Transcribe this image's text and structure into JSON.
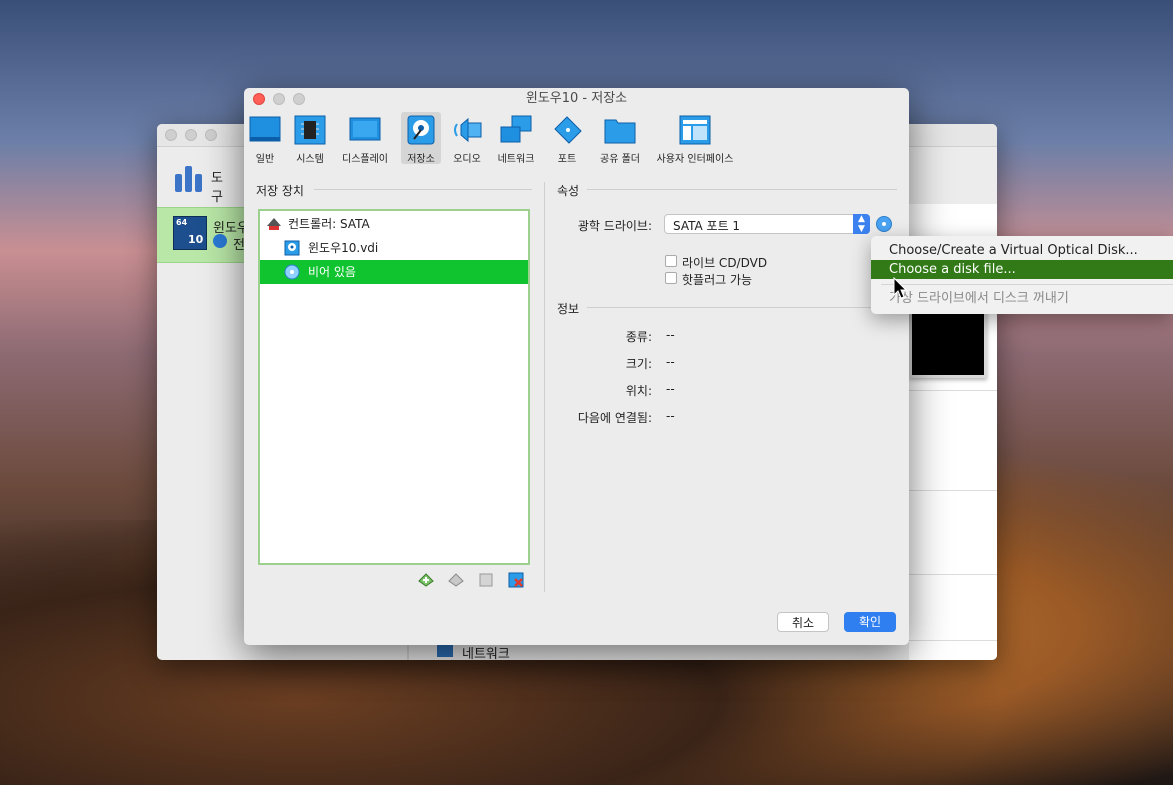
{
  "background_window": {
    "tools_label": "도구",
    "vm_name": "윈도우",
    "vm_state": "전",
    "vm_badge_64": "64",
    "vm_badge_10": "10",
    "bottom_item": "네트워크"
  },
  "dialog": {
    "title": "윈도우10 - 저장소",
    "toolbar": [
      {
        "label": "일반",
        "icon": "general-icon"
      },
      {
        "label": "시스템",
        "icon": "system-chip-icon"
      },
      {
        "label": "디스플레이",
        "icon": "display-icon"
      },
      {
        "label": "저장소",
        "icon": "storage-disk-icon",
        "selected": true
      },
      {
        "label": "오디오",
        "icon": "speaker-icon"
      },
      {
        "label": "네트워크",
        "icon": "network-icon"
      },
      {
        "label": "포트",
        "icon": "port-icon"
      },
      {
        "label": "공유 폴더",
        "icon": "folder-icon"
      },
      {
        "label": "사용자 인터페이스",
        "icon": "user-interface-icon"
      }
    ],
    "storage_devices": {
      "title": "저장 장치",
      "tree": [
        {
          "label": "컨트롤러: SATA",
          "type": "controller"
        },
        {
          "label": "윈도우10.vdi",
          "type": "hard-disk"
        },
        {
          "label": "비어 있음",
          "type": "optical-drive",
          "selected": true
        }
      ]
    },
    "attributes": {
      "title": "속성",
      "optical_drive_label": "광학 드라이브:",
      "optical_drive_value": "SATA 포트 1",
      "live_cd_label": "라이브 CD/DVD",
      "hotplug_label": "핫플러그 가능"
    },
    "info": {
      "title": "정보",
      "rows": [
        {
          "label": "종류:",
          "value": "--"
        },
        {
          "label": "크기:",
          "value": "--"
        },
        {
          "label": "위치:",
          "value": "--"
        },
        {
          "label": "다음에 연결됨:",
          "value": "--"
        }
      ]
    },
    "buttons": {
      "cancel": "취소",
      "ok": "확인"
    }
  },
  "popup_menu": {
    "items": [
      {
        "label": "Choose/Create a Virtual Optical Disk...",
        "state": "normal"
      },
      {
        "label": "Choose a disk file...",
        "state": "highlighted"
      },
      {
        "label": "가상 드라이브에서 디스크 꺼내기",
        "state": "disabled"
      }
    ]
  },
  "colors": {
    "selection_green": "#10c430",
    "menu_highlight": "#317a17",
    "accent_blue": "#2f7ff0",
    "close_red": "#ff5f57"
  }
}
